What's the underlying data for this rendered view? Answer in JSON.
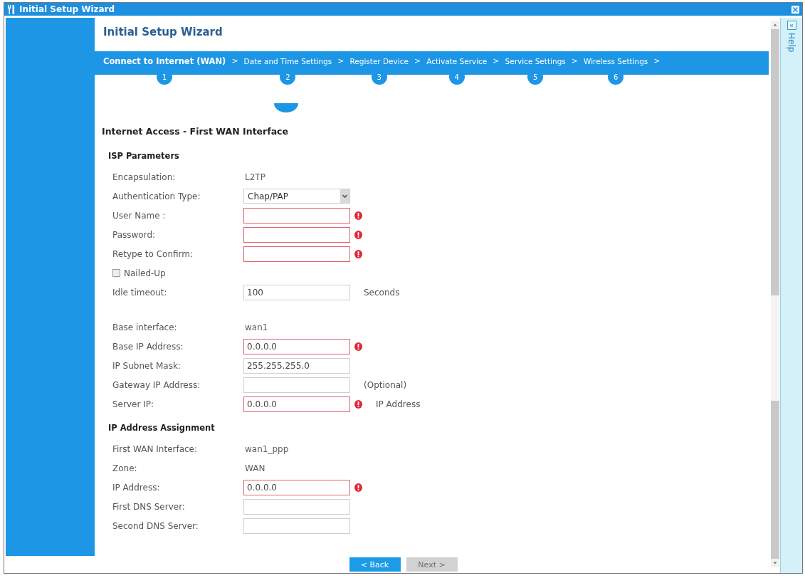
{
  "window": {
    "title": "Initial Setup Wizard"
  },
  "header": {
    "title": "Initial Setup Wizard"
  },
  "steps": [
    {
      "label": "Connect to Internet (WAN)",
      "number": "1",
      "separator": ">",
      "selected": true
    },
    {
      "label": "Date and Time Settings",
      "number": "2",
      "separator": ">",
      "selected": false
    },
    {
      "label": "Register Device",
      "number": "3",
      "separator": ">",
      "selected": false
    },
    {
      "label": "Activate Service",
      "number": "4",
      "separator": ">",
      "selected": false
    },
    {
      "label": "Service Settings",
      "number": "5",
      "separator": ">",
      "selected": false
    },
    {
      "label": "Wireless Settings",
      "number": "6",
      "separator": ">",
      "selected": false
    }
  ],
  "form": {
    "title": "Internet Access - First WAN Interface",
    "sections": [
      {
        "title": "ISP Parameters",
        "groups": [
          {
            "rows": [
              {
                "kind": "text",
                "label": "Encapsulation:",
                "value": "L2TP"
              },
              {
                "kind": "select",
                "label": "Authentication Type:",
                "value": "Chap/PAP"
              },
              {
                "kind": "input",
                "label": "User Name :",
                "required": true
              },
              {
                "kind": "input",
                "label": "Password:",
                "required": true
              },
              {
                "kind": "input",
                "label": "Retype to Confirm:",
                "required": true
              },
              {
                "kind": "checkbox",
                "label": "Nailed-Up",
                "checked": false
              },
              {
                "kind": "input",
                "label": "Idle timeout:",
                "value": "100",
                "required": false,
                "suffix": "Seconds"
              }
            ]
          },
          {
            "rows": [
              {
                "kind": "text",
                "label": "Base interface:",
                "value": "wan1"
              },
              {
                "kind": "input",
                "label": "Base IP Address:",
                "value": "0.0.0.0",
                "required": true
              },
              {
                "kind": "input",
                "label": "IP Subnet Mask:",
                "value": "255.255.255.0",
                "required": false
              },
              {
                "kind": "input",
                "label": "Gateway IP Address:",
                "required": false,
                "suffix": "(Optional)"
              },
              {
                "kind": "input",
                "label": "Server IP:",
                "value": "0.0.0.0",
                "required": true,
                "suffix": "IP Address"
              }
            ]
          }
        ]
      },
      {
        "title": "IP Address Assignment",
        "groups": [
          {
            "rows": [
              {
                "kind": "text",
                "label": "First WAN Interface:",
                "value": "wan1_ppp"
              },
              {
                "kind": "text",
                "label": "Zone:",
                "value": "WAN"
              },
              {
                "kind": "input",
                "label": "IP Address:",
                "value": "0.0.0.0",
                "required": true
              },
              {
                "kind": "input",
                "label": "First DNS Server:",
                "required": false
              },
              {
                "kind": "input",
                "label": "Second DNS Server:",
                "required": false
              }
            ]
          }
        ]
      }
    ]
  },
  "buttons": [
    {
      "label": "< Back",
      "disabled": false
    },
    {
      "label": "Next >",
      "disabled": true
    }
  ],
  "help": {
    "collapse": "«",
    "label": "Help"
  }
}
